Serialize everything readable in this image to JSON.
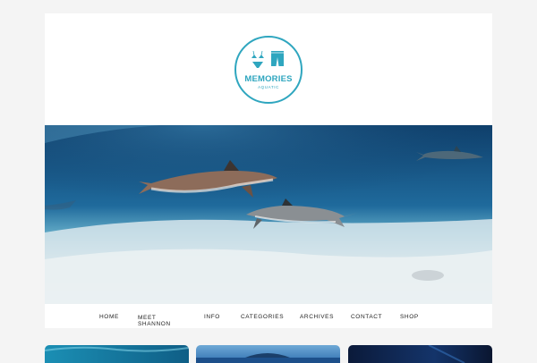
{
  "logo": {
    "title": "MEMORIES",
    "subtitle": "AQUATIC",
    "icons": [
      "bikini-icon",
      "swim-trunks-icon"
    ],
    "color": "#2fa6bf"
  },
  "hero": {
    "subject": "reef sharks over sandy seabed",
    "water_color": "#1f5f8e",
    "sand_color": "#dfe8ec"
  },
  "nav": {
    "items": [
      {
        "label": "HOME"
      },
      {
        "label": "MEET SHANNON"
      },
      {
        "label": "INFO"
      },
      {
        "label": "CATEGORIES"
      },
      {
        "label": "ARCHIVES"
      },
      {
        "label": "CONTACT"
      },
      {
        "label": "SHOP"
      }
    ]
  },
  "thumbnails": [
    {
      "name": "underwater-thumb"
    },
    {
      "name": "island-thumb"
    },
    {
      "name": "dark-water-thumb"
    }
  ],
  "colors": {
    "background": "#f4f4f4",
    "card": "#ffffff",
    "accent": "#2fa6bf",
    "nav_text": "#222222"
  }
}
